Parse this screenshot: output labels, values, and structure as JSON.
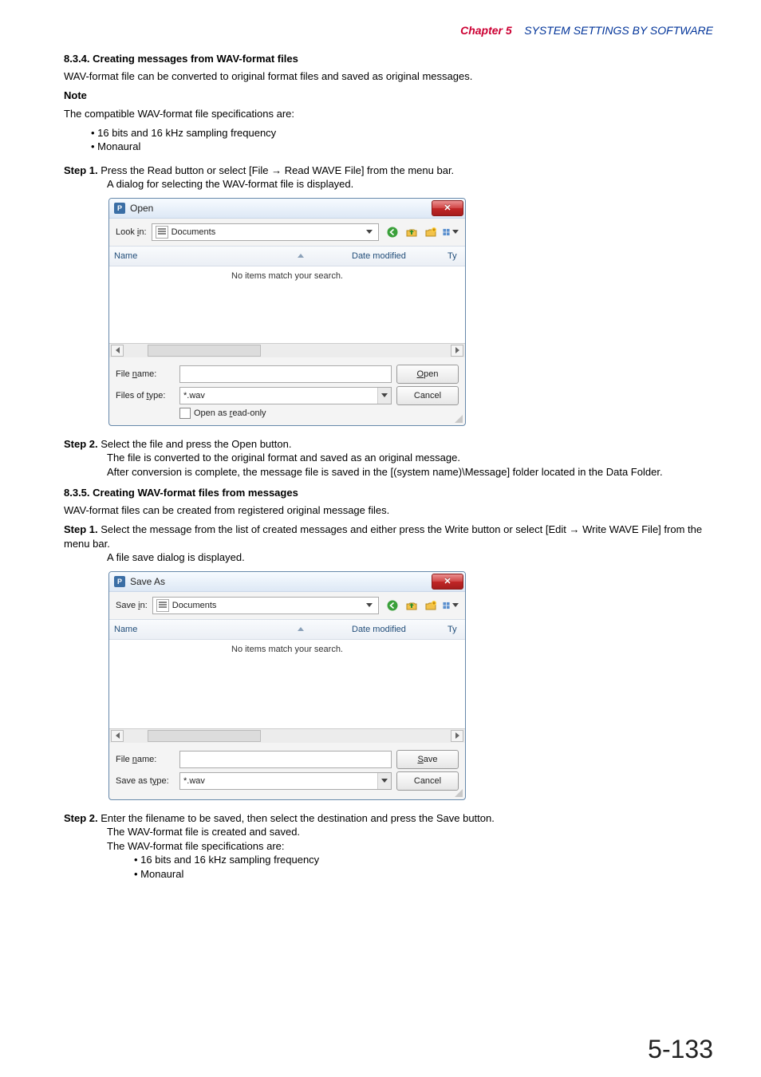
{
  "chapter": {
    "label": "Chapter 5",
    "title": "SYSTEM SETTINGS BY SOFTWARE"
  },
  "s834": {
    "heading": "8.3.4. Creating messages from WAV-format files",
    "intro": "WAV-format file can be converted to original format files and saved as original messages.",
    "noteLabel": "Note",
    "noteIntro": "The compatible WAV-format file specifications are:",
    "spec1": "• 16 bits and 16 kHz sampling frequency",
    "spec2": "• Monaural",
    "step1Label": "Step 1.",
    "step1a": "Press the Read button or select [File → Read WAVE File] from the menu bar.",
    "step1b": "A dialog for selecting the WAV-format file is displayed.",
    "step2Label": "Step 2.",
    "step2a": "Select the file and press the Open button.",
    "step2b": "The file is converted to the original format and saved as an original message.",
    "step2c": "After conversion is complete, the message file is saved in the [(system name)\\Message] folder located in the Data Folder."
  },
  "openDlg": {
    "title": "Open",
    "lookIn_pre": "Look ",
    "lookIn_u": "i",
    "lookIn_post": "n:",
    "folder": "Documents",
    "colName": "Name",
    "colDate": "Date modified",
    "colType": "Ty",
    "empty": "No items match your search.",
    "fileName_pre": "File ",
    "fileName_u": "n",
    "fileName_post": "ame:",
    "filesOfType_pre": "Files of ",
    "filesOfType_u": "t",
    "filesOfType_post": "ype:",
    "typeValue": "*.wav",
    "openBtn_u": "O",
    "openBtn_post": "pen",
    "cancelBtn": "Cancel",
    "readOnly_pre": "Open as ",
    "readOnly_u": "r",
    "readOnly_post": "ead-only"
  },
  "s835": {
    "heading": "8.3.5. Creating WAV-format files from messages",
    "intro": "WAV-format files can be created from registered original message files.",
    "step1Label": "Step 1.",
    "step1a": "Select the message from the list of created messages and either press the Write button or select [Edit → Write WAVE File] from the menu bar.",
    "step1b": "A file save dialog is displayed.",
    "step2Label": "Step 2.",
    "step2a": "Enter the filename to be saved, then select the destination and press the Save button.",
    "step2b": "The WAV-format file is created and saved.",
    "step2c": "The WAV-format file specifications are:",
    "spec1": "• 16 bits and 16 kHz sampling frequency",
    "spec2": "• Monaural"
  },
  "saveDlg": {
    "title": "Save As",
    "saveIn_pre": "Save ",
    "saveIn_u": "i",
    "saveIn_post": "n:",
    "folder": "Documents",
    "colName": "Name",
    "colDate": "Date modified",
    "colType": "Ty",
    "empty": "No items match your search.",
    "fileName_pre": "File ",
    "fileName_u": "n",
    "fileName_post": "ame:",
    "saveAsType_pre": "Save as t",
    "saveAsType_u": "y",
    "saveAsType_post": "pe:",
    "typeValue": "*.wav",
    "saveBtn_u": "S",
    "saveBtn_post": "ave",
    "cancelBtn": "Cancel"
  },
  "pageNo": "5-133"
}
